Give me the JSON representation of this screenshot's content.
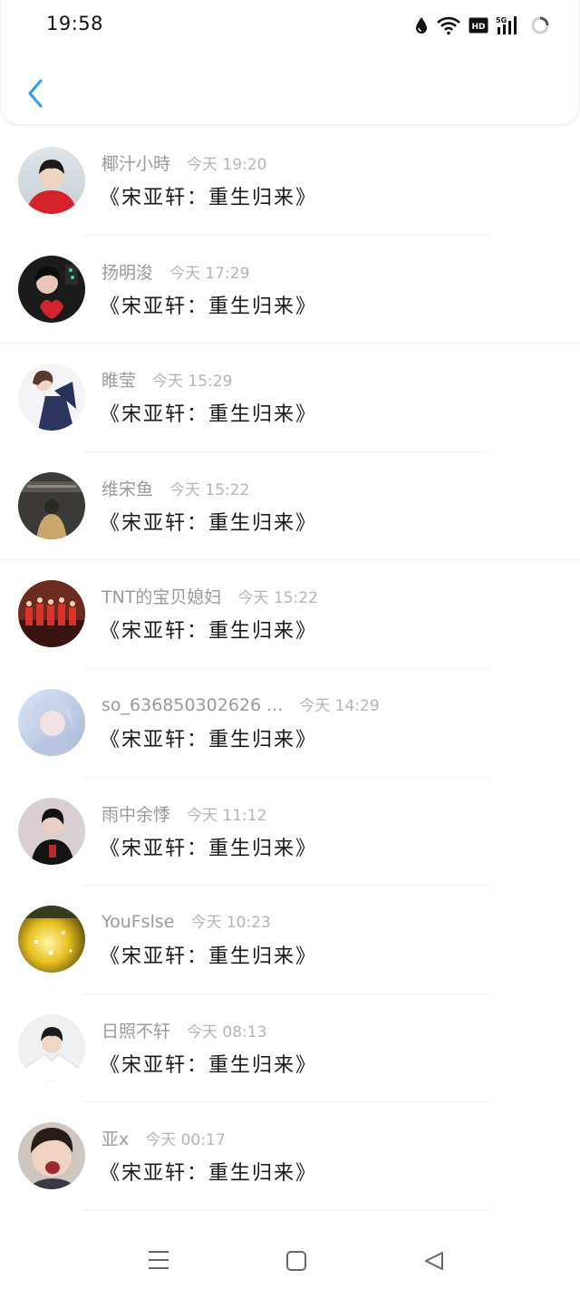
{
  "status_bar": {
    "time": "19:58",
    "icons": [
      "drop-icon",
      "wifi-icon",
      "hd-icon",
      "signal-5g-icon",
      "loading-ring-icon"
    ],
    "hd_label": "HD",
    "net_label": "5G"
  },
  "header": {
    "back_icon": "chevron-left-icon",
    "accent_color": "#2f9bf0"
  },
  "messages": [
    {
      "name": "椰汁小時",
      "time": "今天 19:20",
      "text": "《宋亚轩：重生归来》"
    },
    {
      "name": "扬明浚",
      "time": "今天 17:29",
      "text": "《宋亚轩：重生归来》"
    },
    {
      "name": "睢莹",
      "time": "今天 15:29",
      "text": "《宋亚轩：重生归来》"
    },
    {
      "name": "维宋鱼",
      "time": "今天 15:22",
      "text": "《宋亚轩：重生归来》"
    },
    {
      "name": "TNT的宝贝媳妇",
      "time": "今天 15:22",
      "text": "《宋亚轩：重生归来》"
    },
    {
      "name": "so_636850302626 ...",
      "time": "今天 14:29",
      "text": "《宋亚轩：重生归来》"
    },
    {
      "name": "雨中余悸",
      "time": "今天 11:12",
      "text": "《宋亚轩：重生归来》"
    },
    {
      "name": "YouFslse",
      "time": "今天 10:23",
      "text": "《宋亚轩：重生归来》"
    },
    {
      "name": "日照不轩",
      "time": "今天 08:13",
      "text": "《宋亚轩：重生归来》"
    },
    {
      "name": "亚x",
      "time": "今天 00:17",
      "text": "《宋亚轩：重生归来》"
    }
  ],
  "nav_bar": {
    "icons": [
      "menu-icon",
      "home-square-icon",
      "back-triangle-icon"
    ]
  }
}
